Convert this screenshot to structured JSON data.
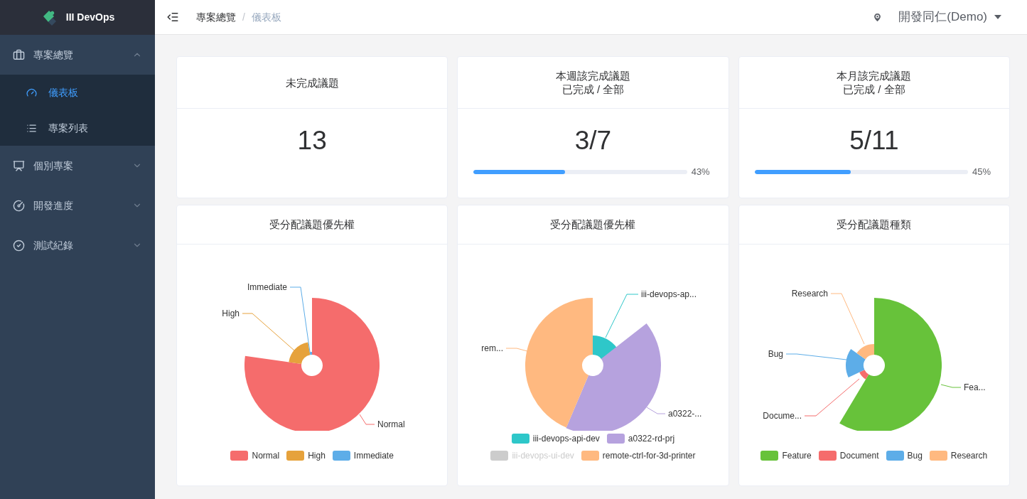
{
  "sidebar": {
    "logo_text": "III DevOps",
    "items": [
      {
        "label": "專案總覽",
        "expanded": true,
        "children": [
          {
            "label": "儀表板",
            "selected": true
          },
          {
            "label": "專案列表",
            "selected": false
          }
        ]
      },
      {
        "label": "個別專案",
        "expanded": false
      },
      {
        "label": "開發進度",
        "expanded": false
      },
      {
        "label": "測試紀錄",
        "expanded": false
      }
    ]
  },
  "header": {
    "breadcrumb": [
      {
        "label": "專案總覽",
        "selected": false
      },
      {
        "label": "儀表板",
        "selected": true
      }
    ],
    "separator": "/",
    "user": "開發同仁(Demo)"
  },
  "stat_cards": [
    {
      "title_lines": [
        "未完成議題"
      ],
      "value": "13"
    },
    {
      "title_lines": [
        "本週該完成議題",
        "已完成 / 全部"
      ],
      "value": "3/7",
      "progress": {
        "level": 0.43,
        "reading": "43%"
      }
    },
    {
      "title_lines": [
        "本月該完成議題",
        "已完成 / 全部"
      ],
      "value": "5/11",
      "progress": {
        "level": 0.45,
        "reading": "45%"
      }
    }
  ],
  "chart_cards": [
    {
      "title": "受分配議題優先權",
      "slices": [
        {
          "callout": "Normal",
          "color": "#f56c6c"
        },
        {
          "callout": "High",
          "color": "#e6a23c"
        },
        {
          "callout": "Immediate",
          "color": "#5dade8"
        }
      ],
      "legend": [
        {
          "label": "Normal",
          "color": "#f56c6c",
          "active": true
        },
        {
          "label": "High",
          "color": "#e6a23c",
          "active": true
        },
        {
          "label": "Immediate",
          "color": "#5dade8",
          "active": true
        }
      ]
    },
    {
      "title": "受分配議題優先權",
      "slices": [
        {
          "callout": "iii-devops-ap...",
          "color": "#2ec7c9"
        },
        {
          "callout": "a0322-...",
          "color": "#b6a2de"
        },
        {
          "callout": "rem...",
          "color": "#ffb980"
        }
      ],
      "legend": [
        {
          "label": "iii-devops-api-dev",
          "color": "#2ec7c9",
          "active": true
        },
        {
          "label": "a0322-rd-prj",
          "color": "#b6a2de",
          "active": true
        },
        {
          "label": "iii-devops-ui-dev",
          "active": false
        },
        {
          "label": "remote-ctrl-for-3d-printer",
          "color": "#ffb980",
          "active": true
        }
      ]
    },
    {
      "title": "受分配議題種類",
      "slices": [
        {
          "callout": "Fea...",
          "color": "#67c23a"
        },
        {
          "callout": "Docume...",
          "color": "#f56c6c"
        },
        {
          "callout": "Bug",
          "color": "#5dade8"
        },
        {
          "callout": "Research",
          "color": "#ffb980"
        }
      ],
      "legend": [
        {
          "label": "Feature",
          "color": "#67c23a",
          "active": true
        },
        {
          "label": "Document",
          "color": "#f56c6c",
          "active": true
        },
        {
          "label": "Bug",
          "color": "#5dade8",
          "active": true
        },
        {
          "label": "Research",
          "color": "#ffb980",
          "active": true
        }
      ]
    }
  ]
}
